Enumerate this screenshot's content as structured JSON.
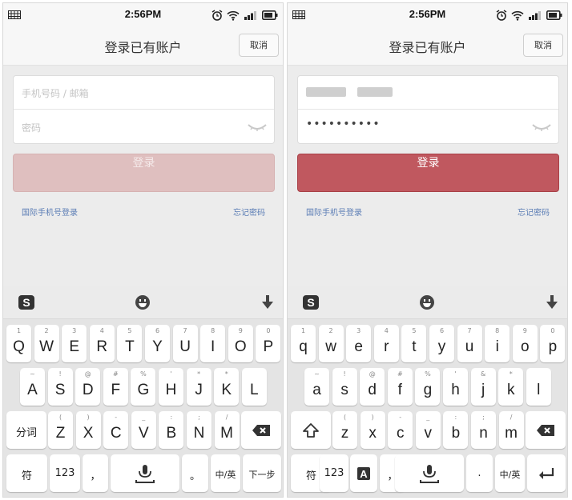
{
  "status": {
    "time": "2:56PM"
  },
  "screen_a": {
    "title": "登录已有账户",
    "cancel": "取消",
    "phone_placeholder": "手机号码 / 邮箱",
    "password_placeholder": "密码",
    "login_button": "登录",
    "intl_login": "国际手机号登录",
    "forgot_password": "忘记密码",
    "keyboard": {
      "row1": [
        {
          "sub": "1",
          "main": "Q"
        },
        {
          "sub": "2",
          "main": "W"
        },
        {
          "sub": "3",
          "main": "E"
        },
        {
          "sub": "4",
          "main": "R"
        },
        {
          "sub": "5",
          "main": "T"
        },
        {
          "sub": "6",
          "main": "Y"
        },
        {
          "sub": "7",
          "main": "U"
        },
        {
          "sub": "8",
          "main": "I"
        },
        {
          "sub": "9",
          "main": "O"
        },
        {
          "sub": "0",
          "main": "P"
        }
      ],
      "row2": [
        {
          "sub": "~",
          "main": "A"
        },
        {
          "sub": "!",
          "main": "S"
        },
        {
          "sub": "@",
          "main": "D"
        },
        {
          "sub": "#",
          "main": "F"
        },
        {
          "sub": "%",
          "main": "G"
        },
        {
          "sub": "'",
          "main": "H"
        },
        {
          "sub": "*",
          "main": "J"
        },
        {
          "sub": "*",
          "main": "K"
        },
        {
          "sub": "",
          "main": "L"
        }
      ],
      "row3_left": "分词",
      "row3": [
        {
          "sub": "(",
          "main": "Z"
        },
        {
          "sub": ")",
          "main": "X"
        },
        {
          "sub": "-",
          "main": "C"
        },
        {
          "sub": "_",
          "main": "V"
        },
        {
          "sub": ":",
          "main": "B"
        },
        {
          "sub": ";",
          "main": "N"
        },
        {
          "sub": "/",
          "main": "M"
        }
      ],
      "row4": {
        "sym": "符",
        "num": "123",
        "comma": "，",
        "period": "。",
        "lang": "中/英",
        "next": "下一步"
      }
    }
  },
  "screen_b": {
    "title": "登录已有账户",
    "cancel": "取消",
    "password_value": "••••••••••",
    "login_button": "登录",
    "intl_login": "国际手机号登录",
    "forgot_password": "忘记密码",
    "keyboard": {
      "row1": [
        {
          "sub": "1",
          "main": "q"
        },
        {
          "sub": "2",
          "main": "w"
        },
        {
          "sub": "3",
          "main": "e"
        },
        {
          "sub": "4",
          "main": "r"
        },
        {
          "sub": "5",
          "main": "t"
        },
        {
          "sub": "6",
          "main": "y"
        },
        {
          "sub": "7",
          "main": "u"
        },
        {
          "sub": "8",
          "main": "i"
        },
        {
          "sub": "9",
          "main": "o"
        },
        {
          "sub": "0",
          "main": "p"
        }
      ],
      "row2": [
        {
          "sub": "~",
          "main": "a"
        },
        {
          "sub": "!",
          "main": "s"
        },
        {
          "sub": "@",
          "main": "d"
        },
        {
          "sub": "#",
          "main": "f"
        },
        {
          "sub": "%",
          "main": "g"
        },
        {
          "sub": "'",
          "main": "h"
        },
        {
          "sub": "&",
          "main": "j"
        },
        {
          "sub": "*",
          "main": "k"
        },
        {
          "sub": "",
          "main": "l"
        }
      ],
      "row3": [
        {
          "sub": "(",
          "main": "z"
        },
        {
          "sub": ")",
          "main": "x"
        },
        {
          "sub": "-",
          "main": "c"
        },
        {
          "sub": "_",
          "main": "v"
        },
        {
          "sub": ":",
          "main": "b"
        },
        {
          "sub": ";",
          "main": "n"
        },
        {
          "sub": "/",
          "main": "m"
        }
      ],
      "row4": {
        "sym": "符",
        "num": "123",
        "comma": "，",
        "period": ".",
        "lang": "中/英"
      }
    }
  },
  "colors": {
    "accent_active": "#c0585f",
    "accent_disabled": "#dfbfbf",
    "link": "#5b7db5"
  },
  "icons": [
    "grid-icon",
    "alarm-icon",
    "wifi-icon",
    "signal-icon",
    "battery-icon",
    "sogou-logo-icon",
    "emoji-icon",
    "hide-keyboard-icon",
    "eye-icon",
    "backspace-icon",
    "shift-icon",
    "mic-icon",
    "enter-icon",
    "a-box-icon"
  ]
}
